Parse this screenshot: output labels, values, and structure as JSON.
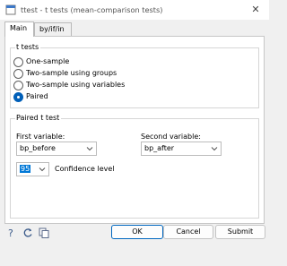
{
  "window": {
    "title": "ttest - t tests (mean-comparison tests)",
    "close_glyph": "✕"
  },
  "tabs": [
    {
      "label": "Main"
    },
    {
      "label": "by/if/in"
    }
  ],
  "ttests": {
    "title": "t tests",
    "options": [
      {
        "label": "One-sample",
        "checked": false
      },
      {
        "label": "Two-sample using groups",
        "checked": false
      },
      {
        "label": "Two-sample using variables",
        "checked": false
      },
      {
        "label": "Paired",
        "checked": true
      }
    ]
  },
  "paired": {
    "title": "Paired t test",
    "first_label": "First variable:",
    "first_value": "bp_before",
    "second_label": "Second variable:",
    "second_value": "bp_after",
    "confidence_value": "95",
    "confidence_label": "Confidence level"
  },
  "footer": {
    "ok": "OK",
    "cancel": "Cancel",
    "submit": "Submit"
  },
  "icons": [
    "help-icon",
    "reset-icon",
    "copy-icon"
  ],
  "colors": {
    "accent": "#005fb8",
    "ok_border": "#0067c0",
    "window_bg": "#f0f0f0"
  }
}
